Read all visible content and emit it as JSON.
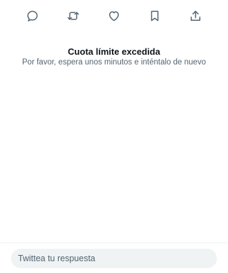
{
  "actions": [
    {
      "icon": "reply-icon"
    },
    {
      "icon": "retweet-icon"
    },
    {
      "icon": "like-heart-icon"
    },
    {
      "icon": "bookmark-icon"
    },
    {
      "icon": "share-icon"
    }
  ],
  "error": {
    "title": "Cuota límite excedida",
    "message": "Por favor, espera unos minutos e inténtalo de nuevo"
  },
  "composer": {
    "placeholder": "Twittea tu respuesta"
  },
  "colors": {
    "icon": "#536471",
    "text_primary": "#0f1419",
    "text_secondary": "#536471",
    "input_background": "#eff3f4"
  }
}
